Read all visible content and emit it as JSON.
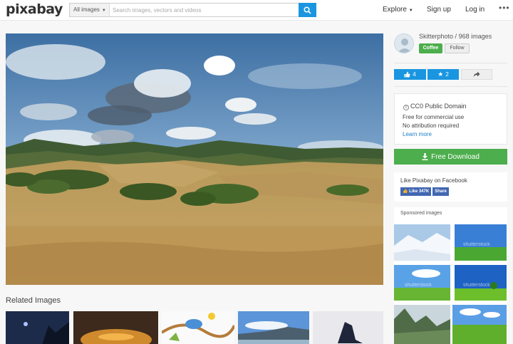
{
  "header": {
    "logo": "pixabay",
    "search_filter": "All images",
    "search_placeholder": "Search images, vectors and videos",
    "nav": {
      "explore": "Explore",
      "signup": "Sign up",
      "login": "Log in",
      "more": "•••"
    }
  },
  "photo": {
    "alt": "Landscape of golden harvested hills under a cloudy blue sky"
  },
  "author": {
    "name": "Skitterphoto",
    "count": "968 images",
    "coffee_label": "Coffee",
    "follow_label": "Follow"
  },
  "stats": {
    "likes": "4",
    "favorites": "2"
  },
  "license": {
    "title": "CC0 Public Domain",
    "line1": "Free for commercial use",
    "line2": "No attribution required",
    "link": "Learn more"
  },
  "download": {
    "label": "Free Download"
  },
  "facebook": {
    "text": "Like Pixabay on Facebook",
    "like_label": "Like 347K",
    "share_label": "Share"
  },
  "sponsored": {
    "title": "Sponsored images",
    "watermark": "shutterstock"
  },
  "related": {
    "title": "Related Images"
  },
  "colors": {
    "accent_blue": "#1a96e0",
    "green": "#4cae4c",
    "facebook": "#4267b2"
  }
}
